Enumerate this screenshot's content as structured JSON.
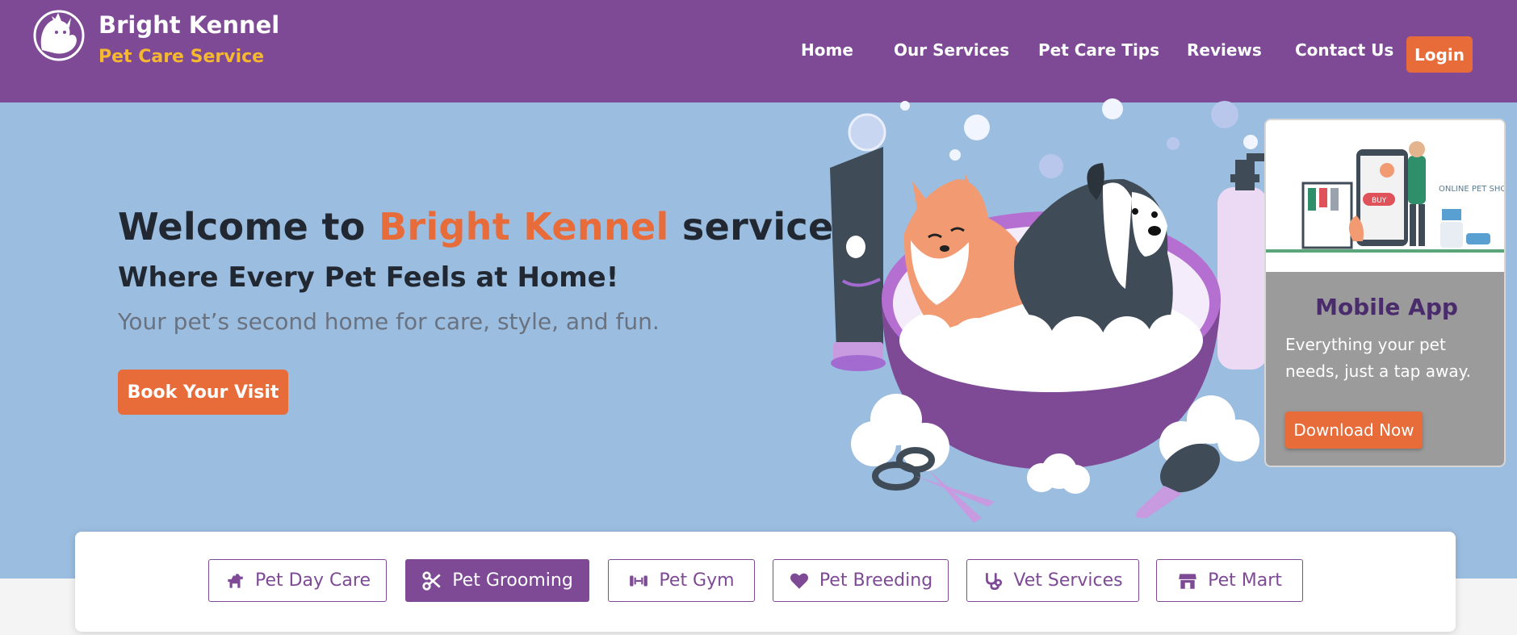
{
  "brand": {
    "title": "Bright Kennel",
    "subtitle": "Pet Care Service",
    "logo_icon": "dog-cat-logo-icon"
  },
  "nav": {
    "items": [
      {
        "label": "Home"
      },
      {
        "label": "Our Services"
      },
      {
        "label": "Pet Care Tips"
      },
      {
        "label": "Reviews"
      },
      {
        "label": "Contact Us"
      }
    ],
    "login_label": "Login"
  },
  "hero": {
    "heading_prefix": "Welcome to ",
    "heading_accent": "Bright Kennel",
    "heading_suffix": " services",
    "subheading": "Where Every Pet Feels at Home!",
    "tagline": "Your pet’s second home for care, style, and fun.",
    "cta_label": "Book Your Visit",
    "illustration_icon": "dog-grooming-bath-illustration"
  },
  "app_card": {
    "image_icon": "online-pet-shop-illustration",
    "image_text_buy": "BUY",
    "image_text_shop": "ONLINE PET SHOP",
    "title": "Mobile App",
    "description": "Everything your pet needs, just a tap away.",
    "button_label": "Download Now"
  },
  "services": [
    {
      "label": "Pet Day Care",
      "icon": "dog-icon",
      "active": false
    },
    {
      "label": "Pet Grooming",
      "icon": "scissors-icon",
      "active": true
    },
    {
      "label": "Pet Gym",
      "icon": "dumbbell-icon",
      "active": false
    },
    {
      "label": "Pet Breeding",
      "icon": "heart-icon",
      "active": false
    },
    {
      "label": "Vet Services",
      "icon": "stethoscope-icon",
      "active": false
    },
    {
      "label": "Pet Mart",
      "icon": "store-icon",
      "active": false
    }
  ],
  "colors": {
    "header_bg": "#7e4a96",
    "accent_orange": "#e86b3a",
    "brand_yellow": "#f5b82e",
    "hero_bg": "#9bbde0",
    "card_title": "#4a2c6c"
  }
}
